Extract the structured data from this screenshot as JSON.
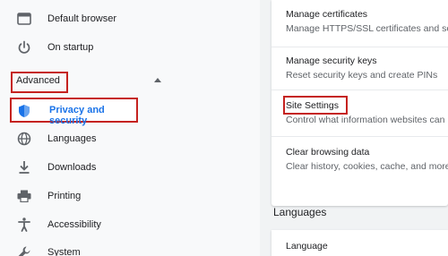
{
  "sidebar": {
    "items": [
      {
        "label": "Default browser",
        "icon": "browser-window-icon"
      },
      {
        "label": "On startup",
        "icon": "power-icon"
      }
    ],
    "advanced_label": "Advanced",
    "advanced_items": [
      {
        "label": "Privacy and security",
        "icon": "shield-icon",
        "selected": true
      },
      {
        "label": "Languages",
        "icon": "globe-icon"
      },
      {
        "label": "Downloads",
        "icon": "download-icon"
      },
      {
        "label": "Printing",
        "icon": "printer-icon"
      },
      {
        "label": "Accessibility",
        "icon": "accessibility-icon"
      },
      {
        "label": "System",
        "icon": "wrench-icon"
      }
    ]
  },
  "main": {
    "rows": [
      {
        "title": "Manage certificates",
        "subtitle": "Manage HTTPS/SSL certificates and se"
      },
      {
        "title": "Manage security keys",
        "subtitle": "Reset security keys and create PINs"
      },
      {
        "title": "Site Settings",
        "subtitle": "Control what information websites can"
      },
      {
        "title": "Clear browsing data",
        "subtitle": "Clear history, cookies, cache, and more"
      }
    ],
    "languages_heading": "Languages",
    "language_row": "Language"
  },
  "colors": {
    "accent": "#1a73e8",
    "highlight": "#c5221f",
    "text": "#202124",
    "secondary_text": "#5f6368"
  }
}
